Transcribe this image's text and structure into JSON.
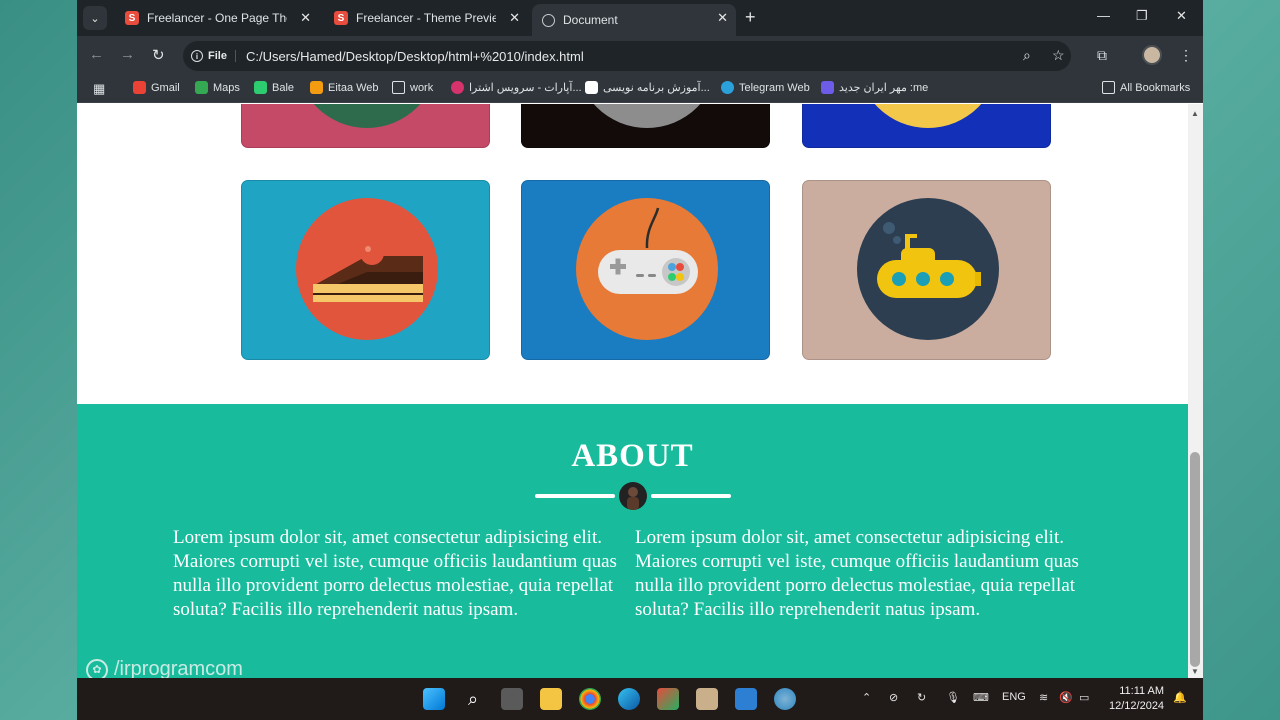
{
  "browser": {
    "tabs": [
      {
        "title": "Freelancer - One Page Theme -",
        "icon": "s-favicon-icon",
        "active": false
      },
      {
        "title": "Freelancer - Theme Preview - St",
        "icon": "s-favicon-icon",
        "active": false
      },
      {
        "title": "Document",
        "icon": "globe-icon",
        "active": true
      }
    ],
    "address_chip": "File",
    "url": "C:/Users/Hamed/Desktop/Desktop/html+%2010/index.html",
    "bookmarks": [
      {
        "label": "Gmail",
        "color": "#ea4335"
      },
      {
        "label": "Maps",
        "color": "#34a853"
      },
      {
        "label": "Bale",
        "color": "#2ecc71"
      },
      {
        "label": "Eitaa Web",
        "color": "#f39c12"
      },
      {
        "label": "work",
        "color": "#dfe3e6"
      },
      {
        "label": "آپارات - سرویس اشترا...",
        "color": "#d6336c"
      },
      {
        "label": "آموزش برنامه نویسی...",
        "color": "#ffffff"
      },
      {
        "label": "Telegram Web",
        "color": "#2aa1da"
      },
      {
        "label": "مهر ایران جدید :me",
        "color": "#6c5ce7"
      }
    ],
    "all_bookmarks": "All Bookmarks"
  },
  "page": {
    "portfolio_cards": [
      {
        "name": "cake",
        "bg": "#1fa4c4",
        "circle": "#e2553d"
      },
      {
        "name": "game-controller",
        "bg": "#1a7cc1",
        "circle": "#e77a37"
      },
      {
        "name": "submarine",
        "bg": "#cbada0",
        "circle": "#2c3e50"
      }
    ],
    "top_cards": [
      {
        "bg": "#c44a67"
      },
      {
        "bg": "#120b0a"
      },
      {
        "bg": "#1331b8"
      }
    ],
    "about": {
      "title": "ABOUT",
      "bg": "#18bc9c",
      "left_paragraph": "Lorem ipsum dolor sit, amet consectetur adipisicing elit. Maiores corrupti vel iste, cumque officiis laudantium quas nulla illo provident porro delectus molestiae, quia repellat soluta? Facilis illo reprehenderit natus ipsam.",
      "right_paragraph": "Lorem ipsum dolor sit, amet consectetur adipisicing elit. Maiores corrupti vel iste, cumque officiis laudantium quas nulla illo provident porro delectus molestiae, quia repellat soluta? Facilis illo reprehenderit natus ipsam."
    }
  },
  "watermark": "/irprogramcom",
  "taskbar": {
    "language": "ENG",
    "time": "11:11 AM",
    "date": "12/12/2024"
  }
}
